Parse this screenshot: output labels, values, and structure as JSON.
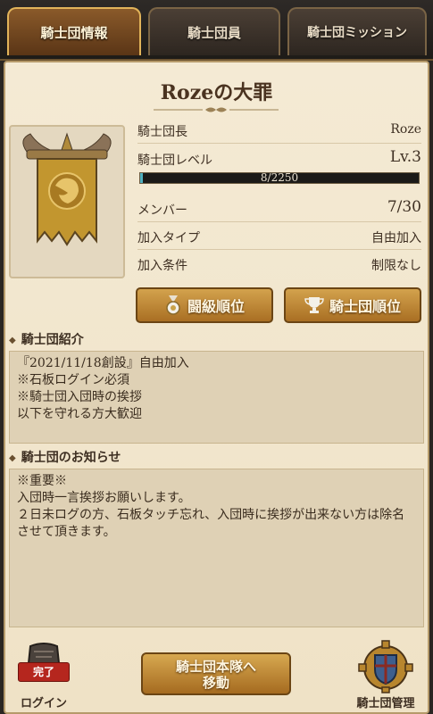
{
  "tabs": [
    {
      "label": "騎士団情報",
      "active": true
    },
    {
      "label": "騎士団員",
      "active": false
    },
    {
      "label": "騎士団ミッション",
      "active": false
    }
  ],
  "guild": {
    "name": "Rozeの大罪",
    "info": {
      "leader_label": "騎士団長",
      "leader_value": "Roze",
      "level_label": "騎士団レベル",
      "level_value": "Lv.3",
      "exp_text": "8/2250",
      "exp_fraction": 0.0036,
      "member_label": "メンバー",
      "member_value": "7/30",
      "join_type_label": "加入タイプ",
      "join_type_value": "自由加入",
      "join_condition_label": "加入条件",
      "join_condition_value": "制限なし"
    }
  },
  "buttons": {
    "arena_rank": "闘級順位",
    "guild_rank": "騎士団順位"
  },
  "intro": {
    "title": "騎士団紹介",
    "text": "『2021/11/18創設』自由加入\n※石板ログイン必須\n※騎士団入団時の挨拶\n以下を守れる方大歓迎"
  },
  "notice": {
    "title": "騎士団のお知らせ",
    "text": "※重要※\n入団時一言挨拶お願いします。\n２日未ログの方、石板タッチ忘れ、入団時に挨拶が出来ない方は除名させて頂きます。"
  },
  "footer": {
    "login_badge": "完了",
    "login_label": "ログイン",
    "move_button_line1": "騎士団本隊へ",
    "move_button_line2": "移動",
    "manage_label": "騎士団管理"
  },
  "colors": {
    "accent_gold": "#c18a34",
    "parchment": "#f1e5cb",
    "exp_bar": "#4fb0c0",
    "done_badge": "#b5261e"
  }
}
